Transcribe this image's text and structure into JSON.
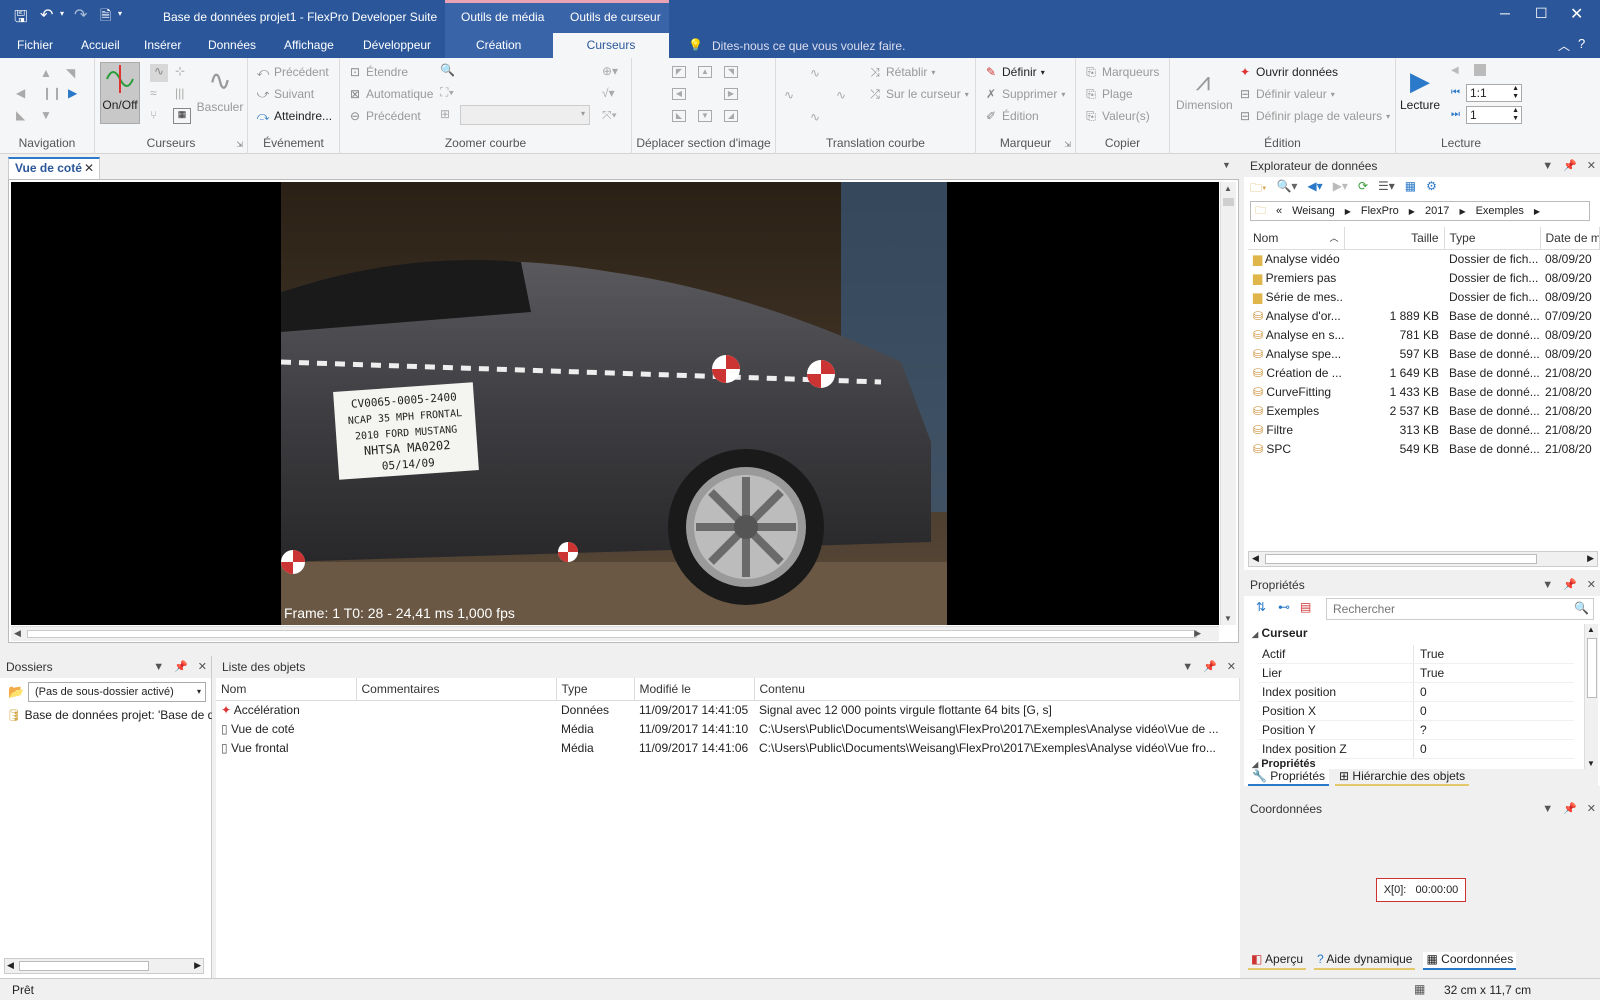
{
  "app": {
    "title": "Base de données projet1 - FlexPro Developer Suite",
    "context_tab_media": "Outils de média",
    "context_tab_cursor": "Outils de cursor"
  },
  "tabs": [
    "Fichier",
    "Accueil",
    "Insérer",
    "Données",
    "Affichage",
    "Développeur",
    "Création",
    "Curseurs"
  ],
  "active_tab": "Curseurs",
  "tell_me": "Dites-nous ce que vous voulez faire.",
  "ribbon": {
    "navigation": {
      "label": "Navigation"
    },
    "curseurs": {
      "label": "Curseurs",
      "onoff": "On/Off",
      "basculer": "Basculer"
    },
    "evenement": {
      "label": "Événement",
      "precedent": "Précédent",
      "suivant": "Suivant",
      "atteindre": "Atteindre..."
    },
    "zoomer": {
      "label": "Zoomer courbe",
      "etendre": "Étendre",
      "automatique": "Automatique",
      "precedent": "Précédent"
    },
    "deplacer": {
      "label": "Déplacer section d'image"
    },
    "translation": {
      "label": "Translation courbe",
      "retablir": "Rétablir",
      "sur_curseur": "Sur le curseur"
    },
    "marqueur": {
      "label": "Marqueur",
      "definir": "Définir",
      "supprimer": "Supprimer",
      "edition": "Édition"
    },
    "copier": {
      "label": "Copier",
      "marqueurs": "Marqueurs",
      "plage": "Plage",
      "valeurs": "Valeur(s)"
    },
    "edition": {
      "label": "Édition",
      "dimension": "Dimension",
      "ouvrir": "Ouvrir données",
      "def_valeur": "Définir valeur",
      "def_plage": "Définir plage de valeurs"
    },
    "lecture": {
      "label": "Lecture",
      "lecture_btn": "Lecture",
      "ratio": "1:1",
      "step": "1"
    }
  },
  "doc_tab": "Vue de coté",
  "video": {
    "overlay": "Frame: 1     T0: 28 - 24,41 ms  1,000 fps",
    "label_lines": [
      "CV0065-0005-2400",
      "NCAP 35 MPH FRONTAL",
      "2010 FORD MUSTANG",
      "NHTSA MA0202",
      "05/14/09"
    ]
  },
  "dossiers": {
    "title": "Dossiers",
    "filter": "(Pas de sous-dossier activé)",
    "item": "Base de données projet: 'Base de do"
  },
  "objets": {
    "title": "Liste des objets",
    "columns": [
      "Nom",
      "Commentaires",
      "Type",
      "Modifié le",
      "Contenu"
    ],
    "rows": [
      {
        "nom": "Accélération",
        "comment": "",
        "type": "Données",
        "modifie": "11/09/2017 14:41:05",
        "contenu": "Signal avec 12 000 points virgule flottante 64 bits [G, s]",
        "icon": "signal-icon"
      },
      {
        "nom": "Vue de coté",
        "comment": "",
        "type": "Média",
        "modifie": "11/09/2017 14:41:10",
        "contenu": "C:\\Users\\Public\\Documents\\Weisang\\FlexPro\\2017\\Exemples\\Analyse vidéo\\Vue de ...",
        "icon": "media-icon"
      },
      {
        "nom": "Vue frontal",
        "comment": "",
        "type": "Média",
        "modifie": "11/09/2017 14:41:06",
        "contenu": "C:\\Users\\Public\\Documents\\Weisang\\FlexPro\\2017\\Exemples\\Analyse vidéo\\Vue fro...",
        "icon": "media-icon"
      }
    ]
  },
  "explorer": {
    "title": "Explorateur de données",
    "path": [
      "«",
      "Weisang",
      "FlexPro",
      "2017",
      "Exemples"
    ],
    "columns": [
      "Nom",
      "Taille",
      "Type",
      "Date de m"
    ],
    "rows": [
      {
        "nom": "Analyse vidéo",
        "taille": "",
        "type": "Dossier de fich...",
        "date": "08/09/20",
        "kind": "folder"
      },
      {
        "nom": "Premiers pas",
        "taille": "",
        "type": "Dossier de fich...",
        "date": "08/09/20",
        "kind": "folder"
      },
      {
        "nom": "Série de mes...",
        "taille": "",
        "type": "Dossier de fich...",
        "date": "08/09/20",
        "kind": "folder"
      },
      {
        "nom": "Analyse d'or...",
        "taille": "1 889 KB",
        "type": "Base de donné...",
        "date": "07/09/20",
        "kind": "db"
      },
      {
        "nom": "Analyse en s...",
        "taille": "781 KB",
        "type": "Base de donné...",
        "date": "08/09/20",
        "kind": "db"
      },
      {
        "nom": "Analyse spe...",
        "taille": "597 KB",
        "type": "Base de donné...",
        "date": "08/09/20",
        "kind": "db"
      },
      {
        "nom": "Création de ...",
        "taille": "1 649 KB",
        "type": "Base de donné...",
        "date": "21/08/20",
        "kind": "db"
      },
      {
        "nom": "CurveFitting",
        "taille": "1 433 KB",
        "type": "Base de donné...",
        "date": "21/08/20",
        "kind": "db"
      },
      {
        "nom": "Exemples",
        "taille": "2 537 KB",
        "type": "Base de donné...",
        "date": "21/08/20",
        "kind": "db"
      },
      {
        "nom": "Filtre",
        "taille": "313 KB",
        "type": "Base de donné...",
        "date": "21/08/20",
        "kind": "db"
      },
      {
        "nom": "SPC",
        "taille": "549 KB",
        "type": "Base de donné...",
        "date": "21/08/20",
        "kind": "db"
      }
    ]
  },
  "properties": {
    "title": "Propriétés",
    "search_placeholder": "Rechercher",
    "section": "Curseur",
    "rows": [
      {
        "name": "Actif",
        "value": "True"
      },
      {
        "name": "Lier",
        "value": "True"
      },
      {
        "name": "Index position",
        "value": "0"
      },
      {
        "name": "Position X",
        "value": "0"
      },
      {
        "name": "Position Y",
        "value": "?"
      },
      {
        "name": "Index position Z",
        "value": "0"
      }
    ],
    "section2": "Propriétés",
    "tab_props": "Propriétés",
    "tab_hier": "Hiérarchie des objets"
  },
  "coords": {
    "title": "Coordonnées",
    "label": "X[0]:",
    "value": "00:00:00",
    "tabs": [
      "Aperçu",
      "Aide dynamique",
      "Coordonnées"
    ]
  },
  "status": {
    "text": "Prêt",
    "size": "32 cm x 11,7 cm"
  }
}
